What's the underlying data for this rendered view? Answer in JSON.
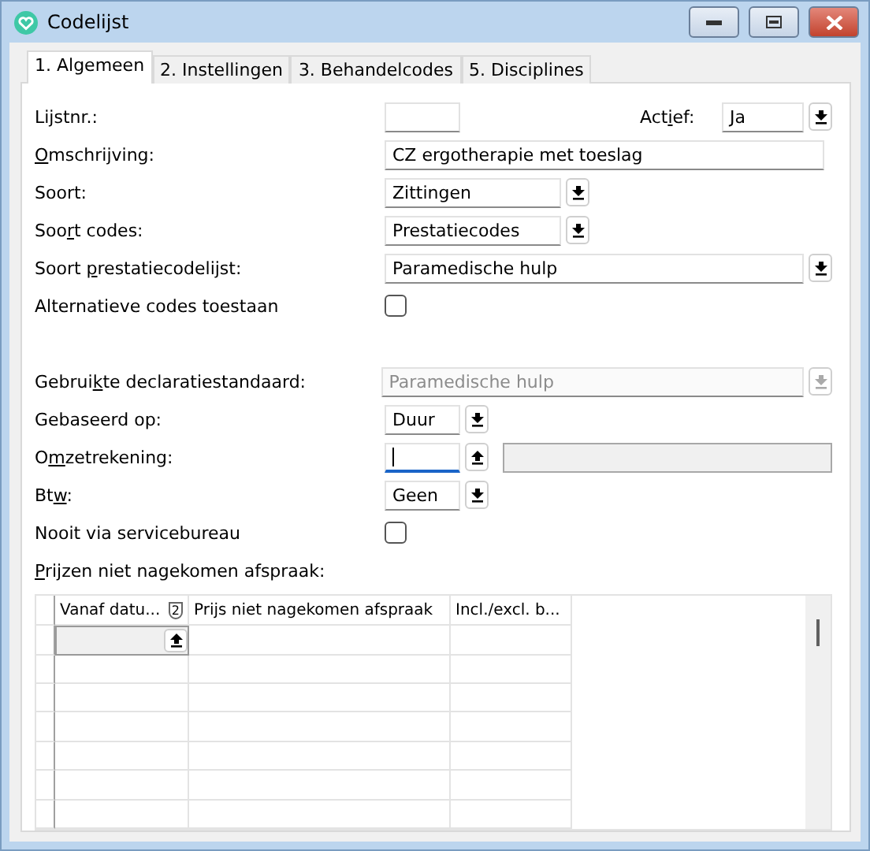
{
  "window": {
    "title": "Codelijst"
  },
  "tabs": [
    {
      "label": "1. Algemeen",
      "selected": true
    },
    {
      "label": "2. Instellingen",
      "selected": false
    },
    {
      "label": "3. Behandelcodes",
      "selected": false
    },
    {
      "label": "5. Disciplines",
      "selected": false
    }
  ],
  "rows": [
    {
      "label": {
        "before": "Lijstnr.:"
      },
      "control": {
        "kind": "text"
      },
      "extra": {
        "label": {
          "before": "Act",
          "key": "i",
          "after": "ef:"
        },
        "control": {
          "kind": "combo",
          "value": "Ja",
          "disabled": false,
          "focused": false
        }
      }
    },
    {
      "label": {
        "key": "O",
        "after": "mschrijving:"
      },
      "control": {
        "kind": "text",
        "value": "CZ ergotherapie met toeslag"
      }
    },
    {
      "label": {
        "before": "Soort:"
      },
      "control": {
        "kind": "combo",
        "value": "Zittingen",
        "disabled": false,
        "focused": false
      }
    },
    {
      "label": {
        "before": "Soo",
        "key": "r",
        "after": "t codes:"
      },
      "control": {
        "kind": "combo",
        "value": "Prestatiecodes",
        "disabled": false,
        "focused": false
      }
    },
    {
      "label": {
        "before": "Soort ",
        "key": "p",
        "after": "restatiecodelijst:"
      },
      "control": {
        "kind": "combo",
        "value": "Paramedische hulp",
        "disabled": false,
        "focused": false
      }
    },
    {
      "label": {
        "before": "Alternatieve codes toestaan"
      },
      "control": {
        "kind": "checkbox",
        "checked": false
      }
    },
    {
      "label": {
        "before": "Gebrui",
        "key": "k",
        "after": "te declaratiestandaard:"
      },
      "control": {
        "kind": "combo",
        "value": "Paramedische hulp",
        "disabled": true,
        "focused": false
      }
    },
    {
      "label": {
        "before": "Gebaseerd op:"
      },
      "control": {
        "kind": "combo",
        "value": "Duur",
        "disabled": false,
        "focused": false
      }
    },
    {
      "label": {
        "before": "O",
        "key": "m",
        "after": "zetrekening:"
      },
      "control": {
        "kind": "combo",
        "disabled": false,
        "focused": true,
        "side_field": {
          "disabled": true
        }
      }
    },
    {
      "label": {
        "before": "Bt",
        "key": "w",
        "after": ":"
      },
      "control": {
        "kind": "combo",
        "value": "Geen",
        "disabled": false,
        "focused": false
      }
    },
    {
      "label": {
        "before": "Nooit via servicebureau"
      },
      "control": {
        "kind": "checkbox",
        "checked": false
      }
    }
  ],
  "grid": {
    "label": {
      "key": "P",
      "after": "rijzen niet nagekomen afspraak:"
    },
    "columns": [
      {
        "label": "Vanaf datu...",
        "sort_badge": "2"
      },
      {
        "label": "Prijs niet nagekomen afspraak"
      },
      {
        "label": "Incl./excl. b..."
      }
    ],
    "rows": [
      {
        "selected": true
      },
      {
        "selected": false
      },
      {
        "selected": false
      },
      {
        "selected": false
      },
      {
        "selected": false
      },
      {
        "selected": false
      },
      {
        "selected": false
      }
    ]
  }
}
